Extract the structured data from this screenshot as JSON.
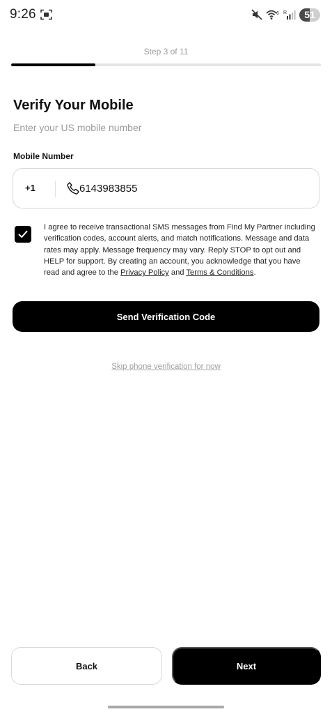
{
  "status_bar": {
    "time": "9:26",
    "network_label": "6",
    "signal_label": "R",
    "battery_level": "51",
    "battery_fraction": 0.51
  },
  "progress": {
    "label": "Step 3 of 11",
    "current": 3,
    "total": 11
  },
  "header": {
    "title": "Verify Your Mobile",
    "subtitle": "Enter your US mobile number"
  },
  "phone": {
    "label": "Mobile Number",
    "country_code": "+1",
    "value": "6143983855"
  },
  "consent": {
    "checked": true,
    "text_before": "I agree to receive transactional SMS messages from Find My Partner including verification codes, account alerts, and match notifications. Message and data rates may apply. Message frequency may vary. Reply STOP to opt out and HELP for support. By creating an account, you acknowledge that you have read and agree to the ",
    "privacy_link": "Privacy Policy",
    "text_middle": " and ",
    "terms_link": "Terms & Conditions",
    "text_after": "."
  },
  "actions": {
    "send_label": "Send Verification Code",
    "skip_label": "Skip phone verification for now",
    "back_label": "Back",
    "next_label": "Next"
  },
  "colors": {
    "primary": "#000000",
    "muted_text": "#9a9a9a",
    "border": "#d8d8d8",
    "progress_track": "#e4e4e4"
  }
}
